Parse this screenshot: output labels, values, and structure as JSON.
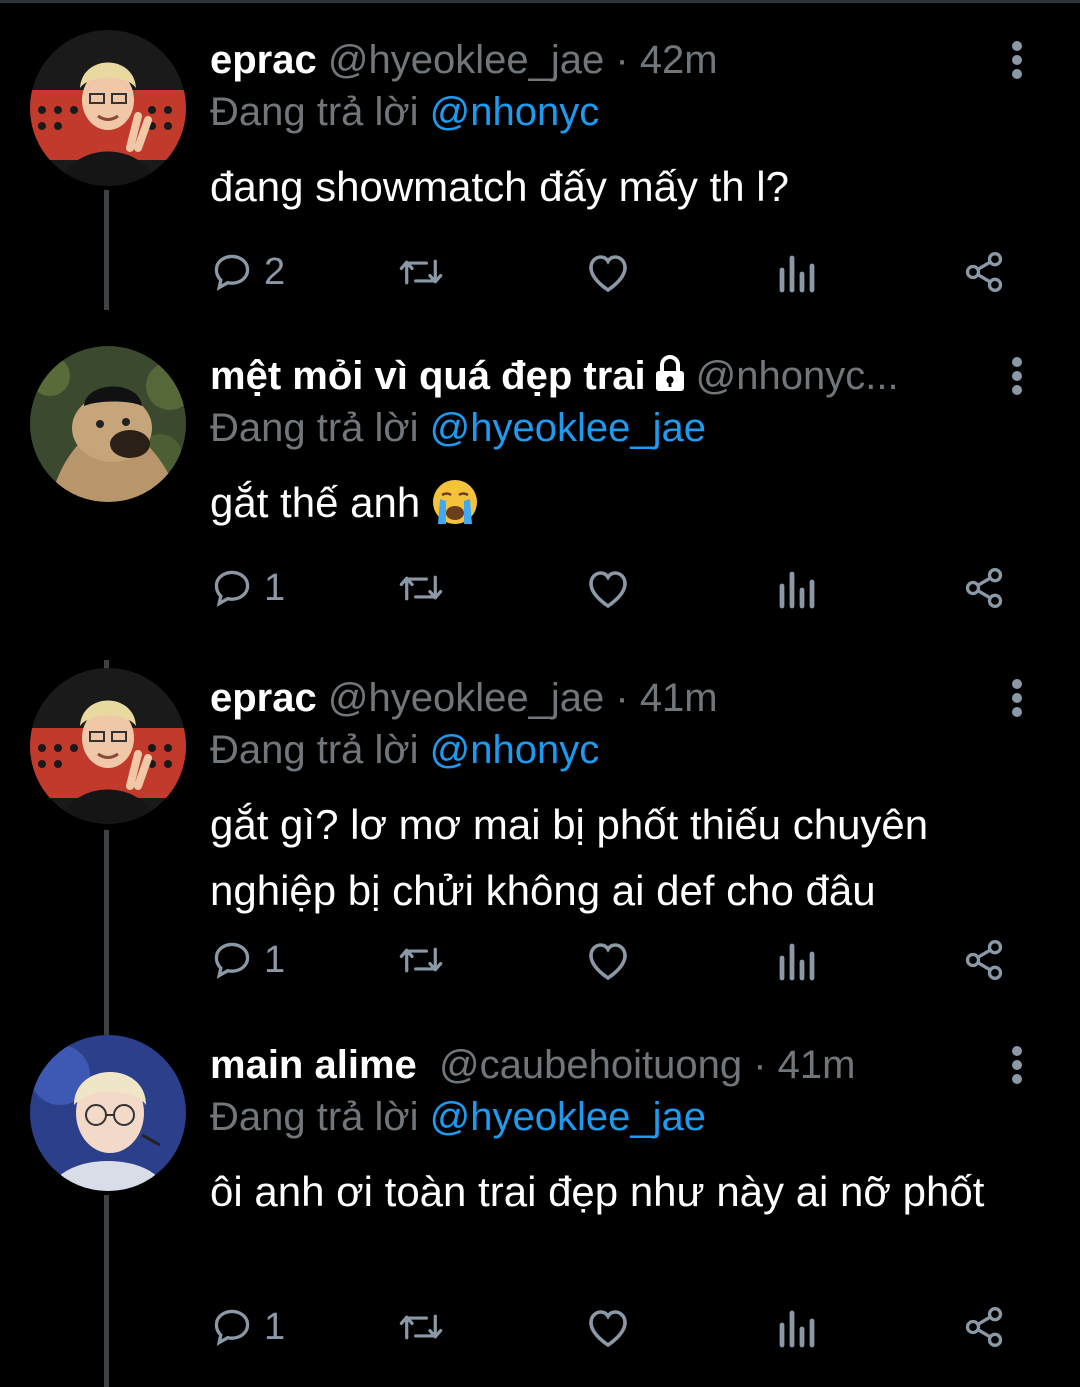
{
  "reply_prefix": "Đang trả lời",
  "tweets": [
    {
      "name": "eprac",
      "handle": "@hyeoklee_jae",
      "separator": "·",
      "time": "42m",
      "reply_to": "@nhonyc",
      "text": "đang showmatch đấy mấy th l?",
      "reply_count": "2"
    },
    {
      "name": "mệt mỏi vì quá đẹp trai",
      "handle": "@nhonyc...",
      "reply_to": "@hyeoklee_jae",
      "text": "gắt thế anh",
      "emoji": "loudly-crying-face",
      "reply_count": "1",
      "protected": true
    },
    {
      "name": "eprac",
      "handle": "@hyeoklee_jae",
      "separator": "·",
      "time": "41m",
      "reply_to": "@nhonyc",
      "text": "gắt gì? lơ mơ mai bị phốt thiếu chuyên nghiệp bị chửi không ai def cho đâu",
      "reply_count": "1"
    },
    {
      "name": "main alime",
      "handle": "@caubehoituong",
      "separator": "·",
      "time": "41m",
      "reply_to": "@hyeoklee_jae",
      "text": "ôi anh ơi toàn trai đẹp như này ai nỡ phốt",
      "reply_count": "1"
    }
  ],
  "colors": {
    "background": "#000000",
    "text": "#ffffff",
    "secondary": "#71767b",
    "link": "#1d9bf0",
    "icon": "#8b98a5"
  }
}
